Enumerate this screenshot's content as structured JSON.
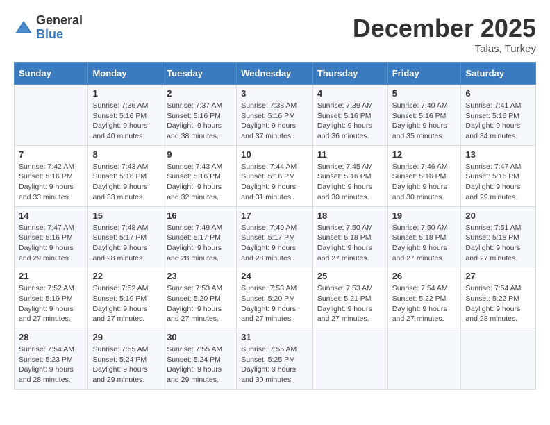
{
  "header": {
    "logo_general": "General",
    "logo_blue": "Blue",
    "month_year": "December 2025",
    "location": "Talas, Turkey"
  },
  "weekdays": [
    "Sunday",
    "Monday",
    "Tuesday",
    "Wednesday",
    "Thursday",
    "Friday",
    "Saturday"
  ],
  "weeks": [
    [
      {
        "day": "",
        "text": ""
      },
      {
        "day": "1",
        "text": "Sunrise: 7:36 AM\nSunset: 5:16 PM\nDaylight: 9 hours\nand 40 minutes."
      },
      {
        "day": "2",
        "text": "Sunrise: 7:37 AM\nSunset: 5:16 PM\nDaylight: 9 hours\nand 38 minutes."
      },
      {
        "day": "3",
        "text": "Sunrise: 7:38 AM\nSunset: 5:16 PM\nDaylight: 9 hours\nand 37 minutes."
      },
      {
        "day": "4",
        "text": "Sunrise: 7:39 AM\nSunset: 5:16 PM\nDaylight: 9 hours\nand 36 minutes."
      },
      {
        "day": "5",
        "text": "Sunrise: 7:40 AM\nSunset: 5:16 PM\nDaylight: 9 hours\nand 35 minutes."
      },
      {
        "day": "6",
        "text": "Sunrise: 7:41 AM\nSunset: 5:16 PM\nDaylight: 9 hours\nand 34 minutes."
      }
    ],
    [
      {
        "day": "7",
        "text": "Sunrise: 7:42 AM\nSunset: 5:16 PM\nDaylight: 9 hours\nand 33 minutes."
      },
      {
        "day": "8",
        "text": "Sunrise: 7:43 AM\nSunset: 5:16 PM\nDaylight: 9 hours\nand 33 minutes."
      },
      {
        "day": "9",
        "text": "Sunrise: 7:43 AM\nSunset: 5:16 PM\nDaylight: 9 hours\nand 32 minutes."
      },
      {
        "day": "10",
        "text": "Sunrise: 7:44 AM\nSunset: 5:16 PM\nDaylight: 9 hours\nand 31 minutes."
      },
      {
        "day": "11",
        "text": "Sunrise: 7:45 AM\nSunset: 5:16 PM\nDaylight: 9 hours\nand 30 minutes."
      },
      {
        "day": "12",
        "text": "Sunrise: 7:46 AM\nSunset: 5:16 PM\nDaylight: 9 hours\nand 30 minutes."
      },
      {
        "day": "13",
        "text": "Sunrise: 7:47 AM\nSunset: 5:16 PM\nDaylight: 9 hours\nand 29 minutes."
      }
    ],
    [
      {
        "day": "14",
        "text": "Sunrise: 7:47 AM\nSunset: 5:16 PM\nDaylight: 9 hours\nand 29 minutes."
      },
      {
        "day": "15",
        "text": "Sunrise: 7:48 AM\nSunset: 5:17 PM\nDaylight: 9 hours\nand 28 minutes."
      },
      {
        "day": "16",
        "text": "Sunrise: 7:49 AM\nSunset: 5:17 PM\nDaylight: 9 hours\nand 28 minutes."
      },
      {
        "day": "17",
        "text": "Sunrise: 7:49 AM\nSunset: 5:17 PM\nDaylight: 9 hours\nand 28 minutes."
      },
      {
        "day": "18",
        "text": "Sunrise: 7:50 AM\nSunset: 5:18 PM\nDaylight: 9 hours\nand 27 minutes."
      },
      {
        "day": "19",
        "text": "Sunrise: 7:50 AM\nSunset: 5:18 PM\nDaylight: 9 hours\nand 27 minutes."
      },
      {
        "day": "20",
        "text": "Sunrise: 7:51 AM\nSunset: 5:18 PM\nDaylight: 9 hours\nand 27 minutes."
      }
    ],
    [
      {
        "day": "21",
        "text": "Sunrise: 7:52 AM\nSunset: 5:19 PM\nDaylight: 9 hours\nand 27 minutes."
      },
      {
        "day": "22",
        "text": "Sunrise: 7:52 AM\nSunset: 5:19 PM\nDaylight: 9 hours\nand 27 minutes."
      },
      {
        "day": "23",
        "text": "Sunrise: 7:53 AM\nSunset: 5:20 PM\nDaylight: 9 hours\nand 27 minutes."
      },
      {
        "day": "24",
        "text": "Sunrise: 7:53 AM\nSunset: 5:20 PM\nDaylight: 9 hours\nand 27 minutes."
      },
      {
        "day": "25",
        "text": "Sunrise: 7:53 AM\nSunset: 5:21 PM\nDaylight: 9 hours\nand 27 minutes."
      },
      {
        "day": "26",
        "text": "Sunrise: 7:54 AM\nSunset: 5:22 PM\nDaylight: 9 hours\nand 27 minutes."
      },
      {
        "day": "27",
        "text": "Sunrise: 7:54 AM\nSunset: 5:22 PM\nDaylight: 9 hours\nand 28 minutes."
      }
    ],
    [
      {
        "day": "28",
        "text": "Sunrise: 7:54 AM\nSunset: 5:23 PM\nDaylight: 9 hours\nand 28 minutes."
      },
      {
        "day": "29",
        "text": "Sunrise: 7:55 AM\nSunset: 5:24 PM\nDaylight: 9 hours\nand 29 minutes."
      },
      {
        "day": "30",
        "text": "Sunrise: 7:55 AM\nSunset: 5:24 PM\nDaylight: 9 hours\nand 29 minutes."
      },
      {
        "day": "31",
        "text": "Sunrise: 7:55 AM\nSunset: 5:25 PM\nDaylight: 9 hours\nand 30 minutes."
      },
      {
        "day": "",
        "text": ""
      },
      {
        "day": "",
        "text": ""
      },
      {
        "day": "",
        "text": ""
      }
    ]
  ]
}
